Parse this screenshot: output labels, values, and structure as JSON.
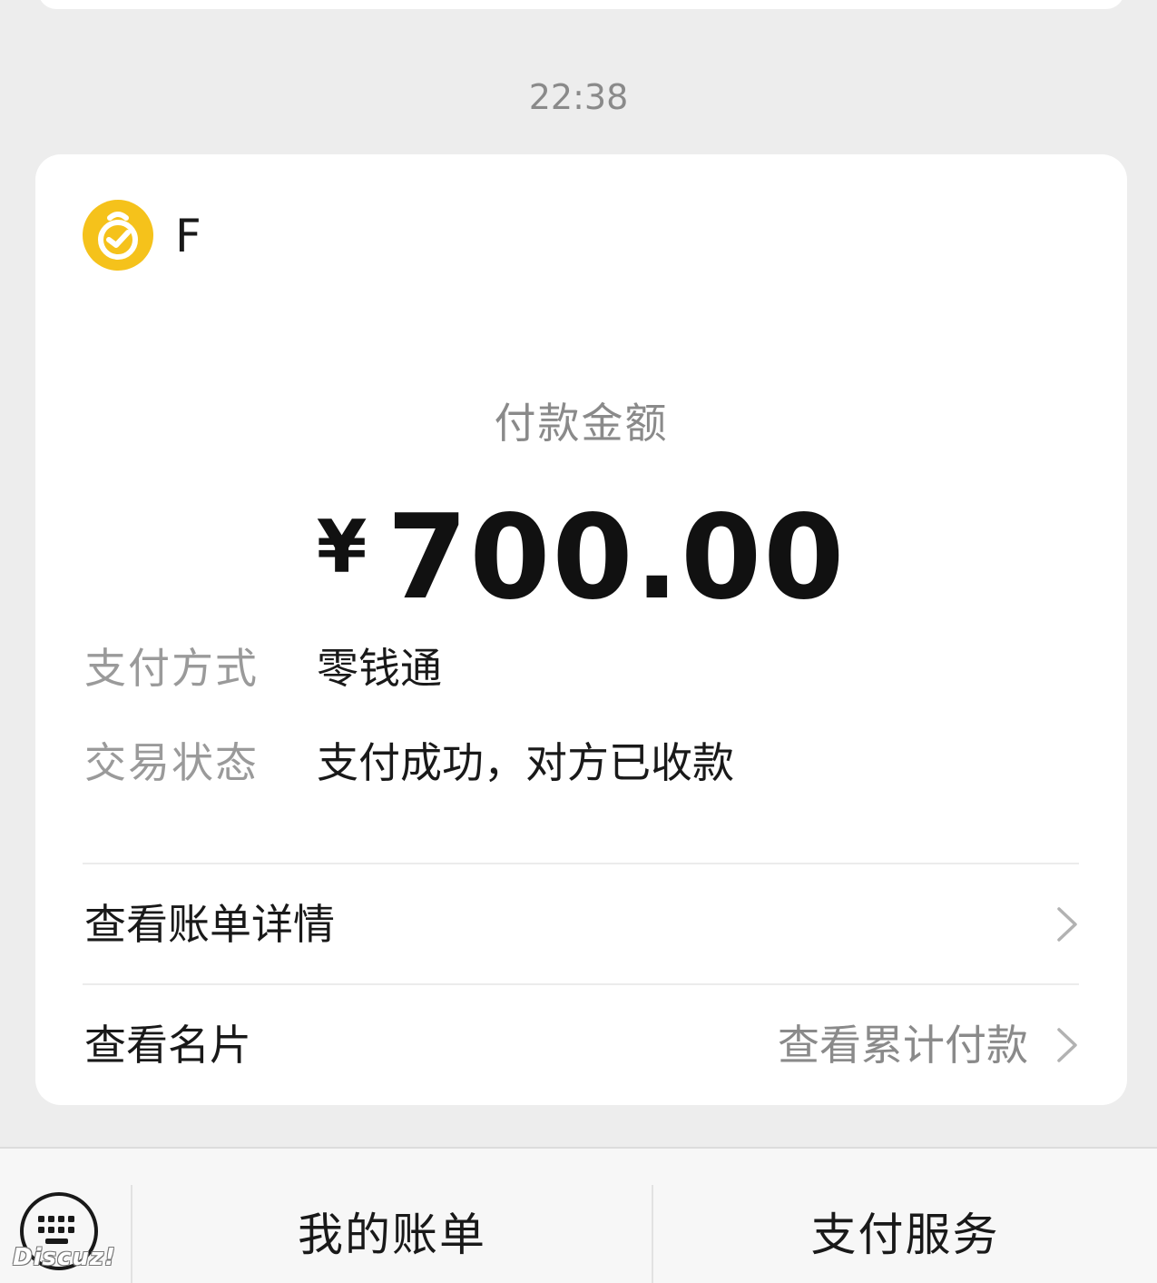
{
  "message": {
    "timestamp": "22:38"
  },
  "payment_card": {
    "merchant_name": "F",
    "merchant_logo_icon": "wechat-pay-merchant-icon",
    "amount_label": "付款金额",
    "currency_symbol": "¥",
    "amount": "700.00",
    "details": [
      {
        "label": "支付方式",
        "value": "零钱通"
      },
      {
        "label": "交易状态",
        "value": "支付成功，对方已收款"
      }
    ],
    "links": [
      {
        "label": "查看账单详情",
        "hint": ""
      },
      {
        "label": "查看名片",
        "hint": "查看累计付款"
      }
    ]
  },
  "bottom_bar": {
    "keyboard_icon": "keyboard-icon",
    "items": [
      {
        "label": "我的账单"
      },
      {
        "label": "支付服务"
      }
    ]
  },
  "watermark": "Discuz!",
  "colors": {
    "background": "#ededed",
    "card": "#ffffff",
    "logo": "#f5c21b",
    "secondary_text": "#8a8a8a",
    "primary_text": "#191919"
  }
}
